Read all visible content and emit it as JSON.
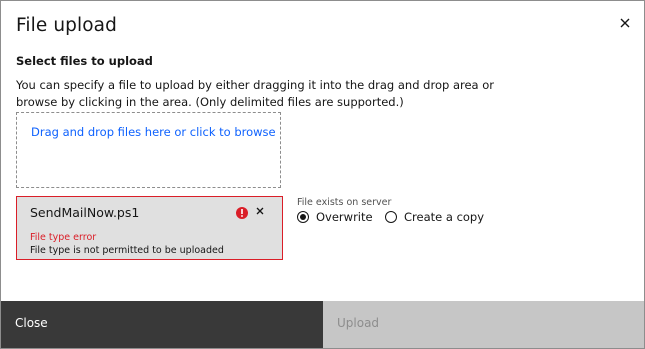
{
  "modal": {
    "title": "File upload",
    "close_icon": "close-icon"
  },
  "upload": {
    "section_title": "Select files to upload",
    "description": "You can specify a file to upload by either dragging it into the drag and drop area or browse by clicking in the area. (Only delimited files are supported.)",
    "dropzone_label": "Drag and drop files here or click to browse"
  },
  "file": {
    "name": "SendMailNow.ps1",
    "status_icon": "error-icon",
    "remove_icon": "close-icon",
    "error_title": "File type error",
    "error_message": "File type is not permitted to be uploaded"
  },
  "conflict": {
    "legend": "File exists on server",
    "options": [
      {
        "label": "Overwrite",
        "selected": true
      },
      {
        "label": "Create a copy",
        "selected": false
      }
    ]
  },
  "footer": {
    "close_label": "Close",
    "upload_label": "Upload",
    "upload_disabled": true
  },
  "colors": {
    "link": "#0f62fe",
    "error": "#da1e28",
    "primary_dark": "#393939",
    "disabled_bg": "#c6c6c6",
    "disabled_text": "#8d8d8d"
  }
}
